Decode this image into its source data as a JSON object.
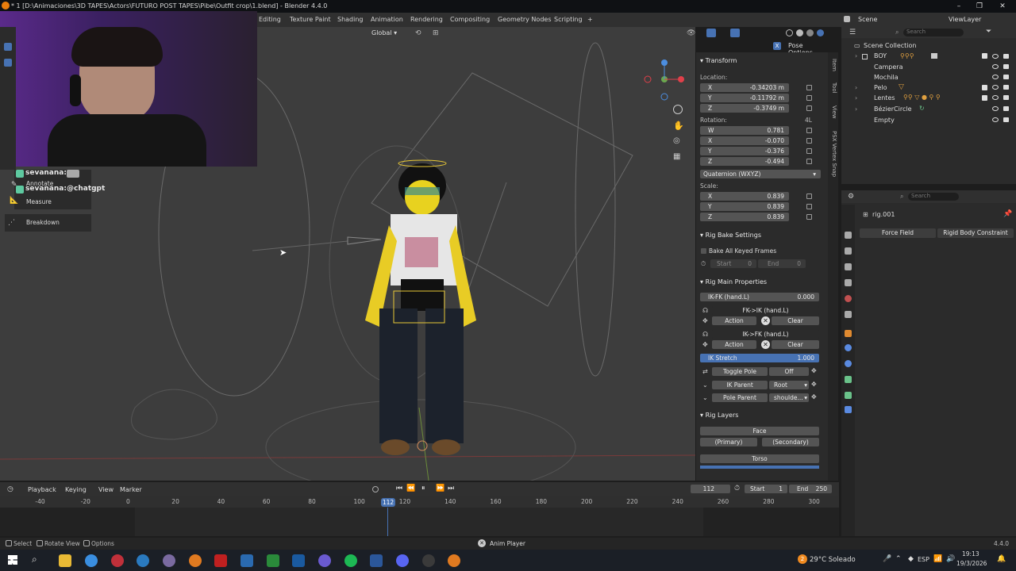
{
  "window": {
    "title": "* 1 [D:\\Animaciones\\3D TAPES\\Actors\\FUTURO POST TAPES\\Pibe\\Outfit crop\\1.blend] - Blender 4.4.0",
    "minimize": "–",
    "maximize": "❐",
    "close": "✕"
  },
  "workspaces": [
    "Editing",
    "Texture Paint",
    "Shading",
    "Animation",
    "Rendering",
    "Compositing",
    "Geometry Nodes",
    "Scripting",
    "+"
  ],
  "scene": {
    "scene_name": "Scene",
    "view_layer": "ViewLayer"
  },
  "viewport_header": {
    "orientation": "Global",
    "pose_options": "Pose Options",
    "x_badge": "X"
  },
  "toolbar": {
    "annotate": "Annotate",
    "measure": "Measure",
    "breakdown": "Breakdown"
  },
  "chat": [
    {
      "user": "sevanana:",
      "message": ""
    },
    {
      "user": "sevanana:",
      "message": "@chatgpt"
    }
  ],
  "transform": {
    "title": "Transform",
    "location_label": "Location:",
    "location": [
      {
        "axis": "X",
        "value": "-0.34203 m"
      },
      {
        "axis": "Y",
        "value": "-0.11792 m"
      },
      {
        "axis": "Z",
        "value": "-0.3749 m"
      }
    ],
    "rotation_label": "Rotation:",
    "rotation_mode_short": "4L",
    "rotation": [
      {
        "axis": "W",
        "value": "0.781"
      },
      {
        "axis": "X",
        "value": "-0.070"
      },
      {
        "axis": "Y",
        "value": "-0.376"
      },
      {
        "axis": "Z",
        "value": "-0.494"
      }
    ],
    "rotation_mode": "Quaternion (WXYZ)",
    "scale_label": "Scale:",
    "scale": [
      {
        "axis": "X",
        "value": "0.839"
      },
      {
        "axis": "Y",
        "value": "0.839"
      },
      {
        "axis": "Z",
        "value": "0.839"
      }
    ]
  },
  "rig_bake": {
    "title": "Rig Bake Settings",
    "bake_all": "Bake All Keyed Frames",
    "start_label": "Start",
    "start_value": "0",
    "end_label": "End",
    "end_value": "0"
  },
  "rig_main": {
    "title": "Rig Main Properties",
    "ik_fk_label": "IK-FK (hand.L)",
    "ik_fk_value": "0.000",
    "fk_ik": "FK->IK (hand.L)",
    "ik_fk_btn": "IK->FK (hand.L)",
    "action": "Action",
    "clear": "Clear",
    "ik_stretch_label": "IK Stretch",
    "ik_stretch_value": "1.000",
    "ik_stretch_fraction": 1.0,
    "toggle_pole": "Toggle Pole",
    "toggle_pole_value": "Off",
    "ik_parent": "IK Parent",
    "ik_parent_value": "Root",
    "pole_parent": "Pole Parent",
    "pole_parent_value": "shoulde..."
  },
  "rig_layers": {
    "title": "Rig Layers",
    "face": "Face",
    "primary": "(Primary)",
    "secondary": "(Secondary)",
    "torso": "Torso"
  },
  "side_tabs": [
    "Item",
    "Tool",
    "View",
    "PSX Vertex Snap"
  ],
  "outliner": {
    "search_placeholder": "Search",
    "collection": "Scene Collection",
    "items": [
      {
        "name": "BOY"
      },
      {
        "name": "Campera"
      },
      {
        "name": "Mochila"
      },
      {
        "name": "Pelo"
      },
      {
        "name": "Lentes"
      },
      {
        "name": "BézierCircle"
      },
      {
        "name": "Empty"
      }
    ]
  },
  "properties": {
    "search_placeholder": "Search",
    "object_name": "rig.001",
    "force_field": "Force Field",
    "rigid_body": "Rigid Body Constraint"
  },
  "timeline": {
    "menus": [
      "Playback",
      "Keying",
      "View",
      "Marker"
    ],
    "current_frame": "112",
    "start_label": "Start",
    "start_value": "1",
    "end_label": "End",
    "end_value": "250",
    "ticks": [
      "-40",
      "-20",
      "0",
      "20",
      "40",
      "60",
      "80",
      "100",
      "120",
      "140",
      "160",
      "180",
      "200",
      "220",
      "240",
      "260",
      "280",
      "300"
    ]
  },
  "status": {
    "select": "Select",
    "rotate_view": "Rotate View",
    "options": "Options",
    "anim_player": "Anim Player",
    "version": "4.4.0"
  },
  "taskbar": {
    "weather": "29°C Soleado",
    "lang": "ESP",
    "time": "19:13",
    "date": "19/3/2026",
    "weather_badge": "2"
  },
  "colors": {
    "accent": "#4772b3",
    "viewport": "#3d3d3d",
    "panel": "#2b2b2b",
    "playhead": "#4772b3"
  }
}
